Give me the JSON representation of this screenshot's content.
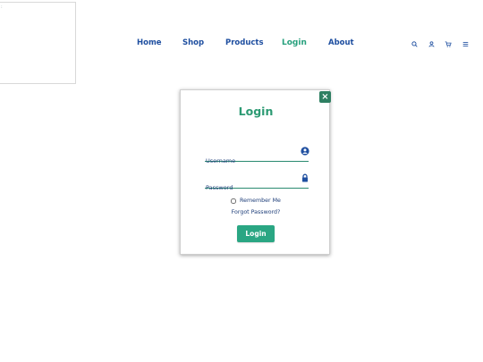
{
  "nav": {
    "items": [
      {
        "label": "Home"
      },
      {
        "label": "Shop"
      },
      {
        "label": "Products"
      },
      {
        "label": "Login",
        "active": true
      },
      {
        "label": "About"
      }
    ],
    "icons": [
      "search-icon",
      "user-icon",
      "cart-icon",
      "menu-icon"
    ]
  },
  "modal": {
    "close_label": "×",
    "title": "Login",
    "username_placeholder": "Username",
    "password_placeholder": "Password",
    "remember_label": "Remember Me",
    "forgot_label": "Forgot Password?",
    "submit_label": "Login"
  },
  "colors": {
    "accent": "#2aa683",
    "nav_text": "#1f4fa0",
    "active_nav": "#27a07d",
    "close_button": "#2e7f62"
  }
}
